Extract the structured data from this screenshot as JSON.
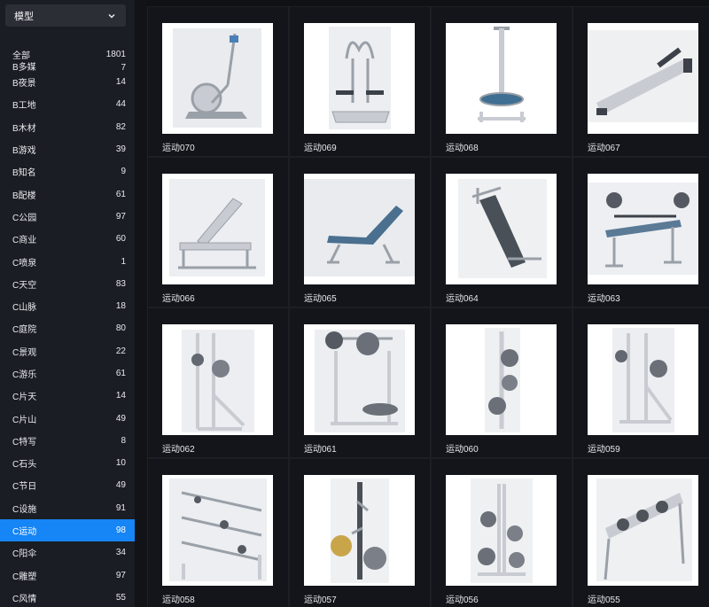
{
  "sidebar": {
    "dropdown_label": "模型",
    "partial_item": {
      "label": "B多媒",
      "count": "7"
    },
    "items": [
      {
        "label": "全部",
        "count": "1801"
      },
      {
        "label": "B多媒",
        "count": "7",
        "cut": true
      },
      {
        "label": "B夜景",
        "count": "14"
      },
      {
        "label": "B工地",
        "count": "44"
      },
      {
        "label": "B木材",
        "count": "82"
      },
      {
        "label": "B游戏",
        "count": "39"
      },
      {
        "label": "B知名",
        "count": "9"
      },
      {
        "label": "B配楼",
        "count": "61"
      },
      {
        "label": "C公园",
        "count": "97"
      },
      {
        "label": "C商业",
        "count": "60"
      },
      {
        "label": "C喷泉",
        "count": "1"
      },
      {
        "label": "C天空",
        "count": "83"
      },
      {
        "label": "C山脉",
        "count": "18"
      },
      {
        "label": "C庭院",
        "count": "80"
      },
      {
        "label": "C景观",
        "count": "22"
      },
      {
        "label": "C游乐",
        "count": "61"
      },
      {
        "label": "C片天",
        "count": "14"
      },
      {
        "label": "C片山",
        "count": "49"
      },
      {
        "label": "C特写",
        "count": "8"
      },
      {
        "label": "C石头",
        "count": "10"
      },
      {
        "label": "C节日",
        "count": "49"
      },
      {
        "label": "C设施",
        "count": "91"
      },
      {
        "label": "C运动",
        "count": "98",
        "active": true
      },
      {
        "label": "C阳伞",
        "count": "34"
      },
      {
        "label": "C雕塑",
        "count": "97"
      },
      {
        "label": "C风情",
        "count": "55"
      }
    ]
  },
  "grid": {
    "items": [
      {
        "label": "运动070",
        "icon": "elliptical-trainer-thumbnail"
      },
      {
        "label": "运动069",
        "icon": "stair-stepper-thumbnail"
      },
      {
        "label": "运动068",
        "icon": "twist-board-thumbnail"
      },
      {
        "label": "运动067",
        "icon": "sit-up-bench-thumbnail"
      },
      {
        "label": "运动066",
        "icon": "incline-bench-thumbnail"
      },
      {
        "label": "运动065",
        "icon": "adjustable-bench-thumbnail"
      },
      {
        "label": "运动064",
        "icon": "ab-board-thumbnail"
      },
      {
        "label": "运动063",
        "icon": "barbell-bench-thumbnail"
      },
      {
        "label": "运动062",
        "icon": "squat-rack-thumbnail"
      },
      {
        "label": "运动061",
        "icon": "weight-rack-thumbnail"
      },
      {
        "label": "运动060",
        "icon": "plate-tree-thumbnail"
      },
      {
        "label": "运动059",
        "icon": "plate-stand-thumbnail"
      },
      {
        "label": "运动058",
        "icon": "dumbbell-rack-thumbnail"
      },
      {
        "label": "运动057",
        "icon": "plate-pole-thumbnail"
      },
      {
        "label": "运动056",
        "icon": "plate-tower-thumbnail"
      },
      {
        "label": "运动055",
        "icon": "dumbbell-shelf-thumbnail"
      }
    ]
  },
  "colors": {
    "active": "#1685f5",
    "sidebar": "#1a1d23",
    "grid_bg": "#0f1115"
  }
}
